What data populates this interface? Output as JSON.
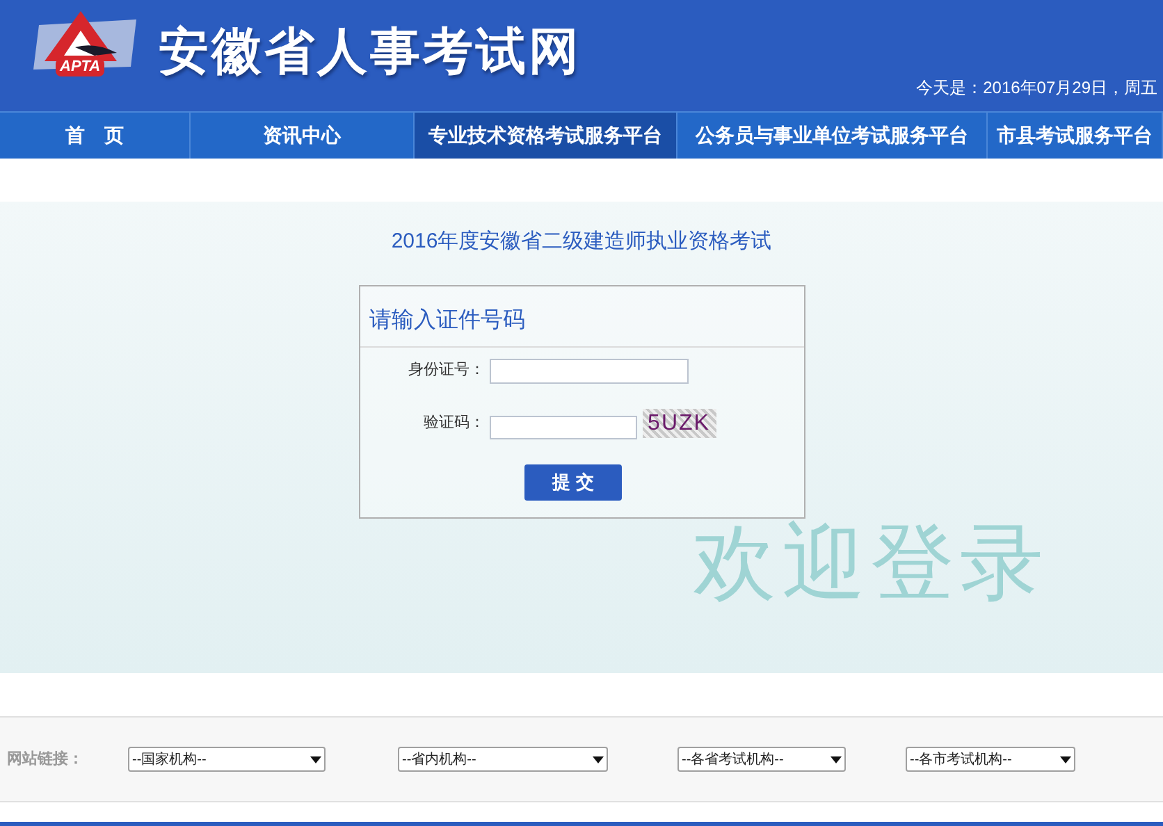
{
  "header": {
    "logo_text": "APTA",
    "site_title": "安徽省人事考试网",
    "date": "今天是：2016年07月29日，周五"
  },
  "nav": [
    {
      "label": "首　页",
      "selected": false
    },
    {
      "label": "资讯中心",
      "selected": false
    },
    {
      "label": "专业技术资格考试服务平台",
      "selected": true
    },
    {
      "label": "公务员与事业单位考试服务平台",
      "selected": false
    },
    {
      "label": "市县考试服务平台",
      "selected": false
    }
  ],
  "page_title": "2016年度安徽省二级建造师执业资格考试",
  "form": {
    "title": "请输入证件号码",
    "fields": [
      {
        "label": "身份证号：",
        "kind": "text"
      },
      {
        "label": "验证码：",
        "kind": "captcha",
        "captcha": "5UZK"
      }
    ],
    "submit": "提 交"
  },
  "welcome": "欢迎登录",
  "links": {
    "label": "网站链接：",
    "selects": [
      "--国家机构--",
      "--省内机构--",
      "--各省考试机构--",
      "--各市考试机构--"
    ]
  }
}
